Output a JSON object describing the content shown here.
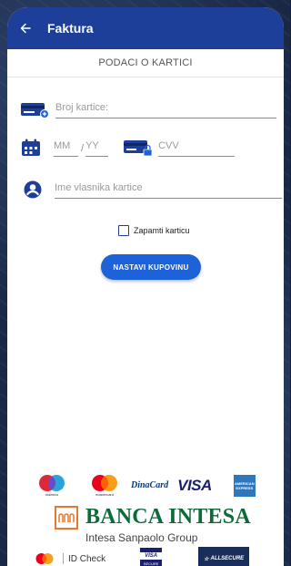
{
  "app": {
    "title": "Faktura",
    "back_icon": "arrow-left-icon"
  },
  "colors": {
    "appbar": "#1d3f99",
    "accent": "#1d62d8",
    "icon": "#1d3f99"
  },
  "card_section": {
    "title": "PODACI O KARTICI",
    "card_number": {
      "placeholder": "Broj kartice:",
      "value": ""
    },
    "expiry_month": {
      "placeholder": "MM",
      "value": ""
    },
    "expiry_separator": "/",
    "expiry_year": {
      "placeholder": "YY",
      "value": ""
    },
    "cvv": {
      "placeholder": "CVV",
      "value": ""
    },
    "holder_name": {
      "placeholder": "Ime vlasnika kartice",
      "value": ""
    },
    "remember_card": {
      "label": "Zapamti karticu",
      "checked": false
    },
    "continue_button": "NASTAVI KUPOVINU"
  },
  "footer_logos": {
    "maestro_caption": "maestro",
    "mastercard_caption": "mastercard",
    "diners": "DinaCard",
    "visa": "VISA",
    "amex": "AMERICAN EXPRESS",
    "bank_name": "BANCA INTESA",
    "bank_group": "Intesa Sanpaolo Group",
    "id_check": "ID Check",
    "visa_secure_top": "VISA",
    "visa_secure_bottom": "SECURE",
    "allsecure": "ALLSECURE"
  }
}
